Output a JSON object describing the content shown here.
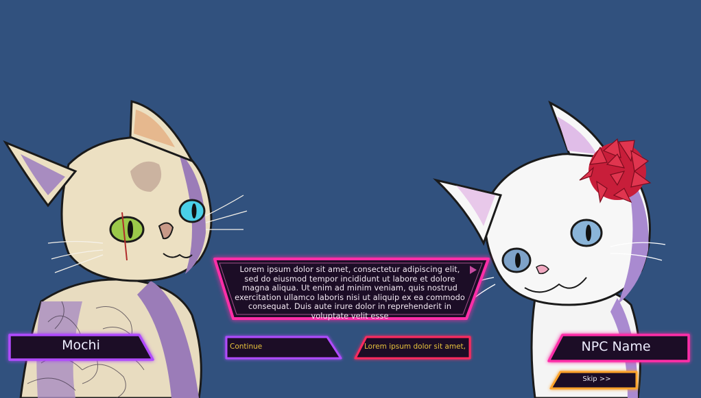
{
  "characters": {
    "left": {
      "name": "Mochi"
    },
    "right": {
      "name": "NPC Name"
    }
  },
  "dialogue": {
    "text": "Lorem ipsum dolor sit amet, consectetur adipiscing elit, sed do eiusmod tempor incididunt ut labore et dolore magna aliqua. Ut enim ad minim veniam, quis nostrud exercitation ullamco laboris nisi ut aliquip ex ea commodo consequat. Duis aute irure dolor in reprehenderit in voluptate velit esse"
  },
  "choices": {
    "continue_label": "Continue",
    "option_label": "Lorem ipsum dolor sit amet,"
  },
  "skip_label": "Skip >>",
  "colors": {
    "background": "#31517e",
    "neon_pink": "#ff2fa8",
    "neon_purple": "#b14cff",
    "neon_red": "#ff2a5e",
    "neon_orange": "#ffa32a",
    "panel_fill": "#1c0f26",
    "choice_text": "#e8c33c"
  }
}
